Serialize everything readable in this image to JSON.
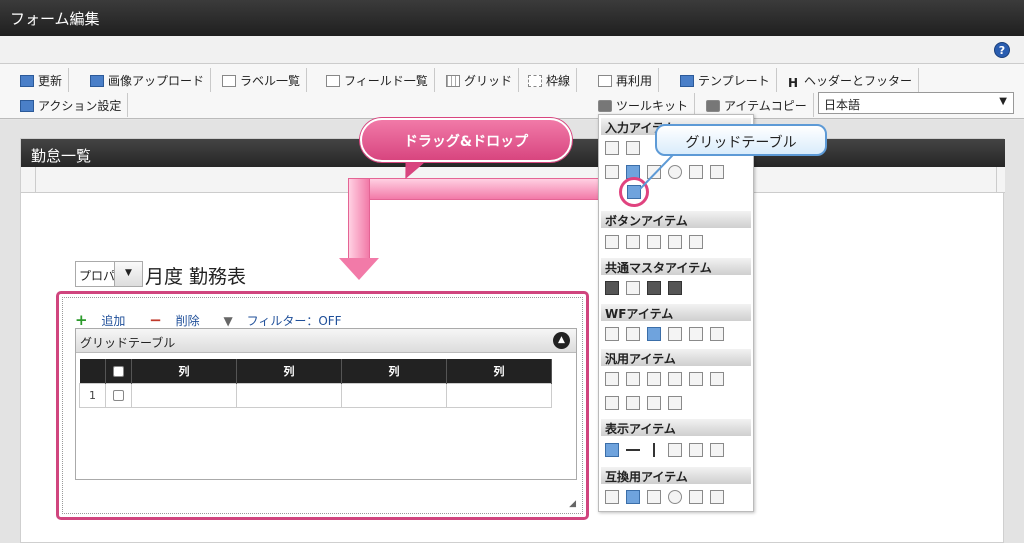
{
  "window": {
    "title": "フォーム編集"
  },
  "help": {
    "label": "?"
  },
  "toolbar": {
    "row1": [
      {
        "label": "更新",
        "icon": "refresh-icon"
      },
      {
        "label": "画像アップロード",
        "icon": "image-upload-icon"
      },
      {
        "label": "ラベル一覧",
        "icon": "label-list-icon"
      },
      {
        "label": "フィールド一覧",
        "icon": "field-list-icon"
      },
      {
        "label": "グリッド",
        "icon": "grid-icon"
      },
      {
        "label": "枠線",
        "icon": "border-icon"
      },
      {
        "label": "再利用",
        "icon": "reuse-icon"
      },
      {
        "label": "テンプレート",
        "icon": "template-icon"
      },
      {
        "label": "ヘッダーとフッター",
        "icon": "header-footer-icon",
        "glyph": "H"
      }
    ],
    "row2": [
      {
        "label": "アクション設定",
        "icon": "action-settings-icon"
      },
      {
        "label": "ツールキット",
        "icon": "toolkit-icon"
      },
      {
        "label": "アイテムコピー",
        "icon": "item-copy-icon"
      }
    ],
    "language": {
      "value": "日本語",
      "caret": "▼"
    }
  },
  "form": {
    "title": "勤怠一覧",
    "combo_value": "プロパ",
    "month_title": "月度 勤務表",
    "grid_actions": {
      "add": "追加",
      "delete": "削除",
      "filter": "フィルター：OFF"
    },
    "grid": {
      "caption": "グリッドテーブル",
      "columns": [
        "列",
        "列",
        "列",
        "列"
      ],
      "rows": [
        {
          "number": "1"
        }
      ]
    }
  },
  "callouts": {
    "drag": "ドラッグ&ドロップ",
    "grid_table": "グリッドテーブル"
  },
  "palette": {
    "sections": [
      {
        "title": "入力アイテム"
      },
      {
        "title": "ボタンアイテム"
      },
      {
        "title": "共通マスタアイテム"
      },
      {
        "title": "WFアイテム"
      },
      {
        "title": "汎用アイテム"
      },
      {
        "title": "表示アイテム"
      },
      {
        "title": "互換用アイテム"
      }
    ]
  },
  "colors": {
    "accent_pink": "#d8457f",
    "callout_blue": "#5d9ad6",
    "header_dark": "#262626"
  }
}
